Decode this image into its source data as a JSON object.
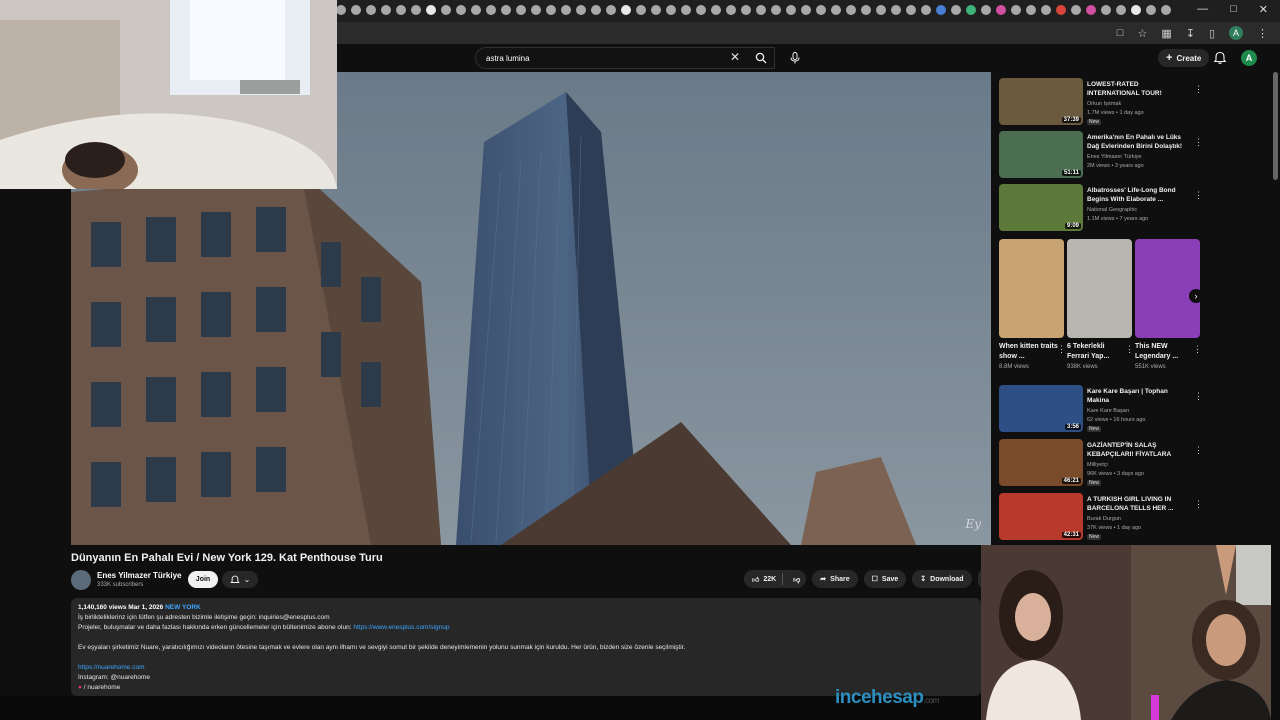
{
  "browser": {
    "tab_icon_count": 56,
    "profile_initial": "A"
  },
  "header": {
    "search_query": "astra lumina",
    "create_label": "Create",
    "avatar_initial": "A"
  },
  "video": {
    "title": "Dünyanın En Pahalı Evi / New York 129. Kat Penthouse Turu",
    "channel_name": "Enes Yilmazer Türkiye",
    "subscribers": "333K subscribers",
    "join_label": "Join",
    "likes": "22K",
    "share_label": "Share",
    "save_label": "Save",
    "download_label": "Download",
    "watermark": "Ey"
  },
  "description": {
    "meta": "1,140,160 views  Mar 1, 2026",
    "tag": "NEW YORK",
    "line1": "İş birlikteliklerinz için lütfen şu adresten bizimle iletişime geçin: inquiries@enesplus.com",
    "line2_prefix": "Projeler, buluşmalar ve daha fazlası hakkında erken güncellemeler için bültenimize abone olun: ",
    "line2_link": "https://www.enesplus.com/signup",
    "line3": "Ev eşyaları şirketimiz Nuare, yaratıcılığımızı videoların ötesine taşımak ve evlere olan aynı ilhamı ve sevgiyi somut bir şekilde deneyimlemenin yolunu sunmak için kuruldu. Her ürün, bizden size özenle seçilmiştir.",
    "link2": "https://nuarehome.com",
    "instagram": "Instagram: @nuarehome",
    "other": "/ nuarehome"
  },
  "sidebar": {
    "recs_top": [
      {
        "title": "LOWEST-RATED INTERNATIONAL TOUR!",
        "channel": "Orkun Işıtmak",
        "views": "1.7M views • 1 day ago",
        "badge": "New",
        "duration": "37:39",
        "thumb_color": "#6b5a3e"
      },
      {
        "title": "Amerika'nın En Pahalı ve Lüks Dağ Evlerinden Birini Dolaştık!",
        "channel": "Enes Yilmazer Türkiye",
        "views": "2M views • 3 years ago",
        "badge": "",
        "duration": "51:11",
        "thumb_color": "#4b6d52"
      },
      {
        "title": "Albatrosses' Life-Long Bond Begins With Elaborate ...",
        "channel": "National Geographic",
        "views": "1.1M views • 7 years ago",
        "badge": "",
        "duration": "9:09",
        "thumb_color": "#5d7a3b"
      }
    ],
    "shorts": [
      {
        "title": "When kitten traits show ...",
        "views": "8.8M views",
        "thumb_color": "#c8a472"
      },
      {
        "title": "6 Tekerlekli Ferrari Yap...",
        "views": "938K views",
        "thumb_color": "#b9b6b0"
      },
      {
        "title": "This NEW Legendary ...",
        "views": "551K views",
        "thumb_color": "#8a3fb8"
      }
    ],
    "recs_bottom": [
      {
        "title": "Kare Kare Başarı | Tophan Makina",
        "channel": "Kare Kare Başarı",
        "views": "62 views • 16 hours ago",
        "badge": "New",
        "duration": "3:56",
        "thumb_color": "#2d4f86"
      },
      {
        "title": "GAZİANTEP'İN SALAŞ KEBAPÇILARI! FİYATLARA ŞO...",
        "channel": "Milliyetçi",
        "views": "96K views • 3 days ago",
        "badge": "New",
        "duration": "46:21",
        "thumb_color": "#7a4b2a"
      },
      {
        "title": "A TURKISH GIRL LIVING IN BARCELONA TELLS HER ...",
        "channel": "Burak Durgun",
        "views": "37K views • 1 day ago",
        "badge": "New",
        "duration": "42:31",
        "thumb_color": "#b83a2c"
      }
    ]
  },
  "overlay": {
    "watermark_main": "incehesap",
    "watermark_suffix": ".com"
  }
}
